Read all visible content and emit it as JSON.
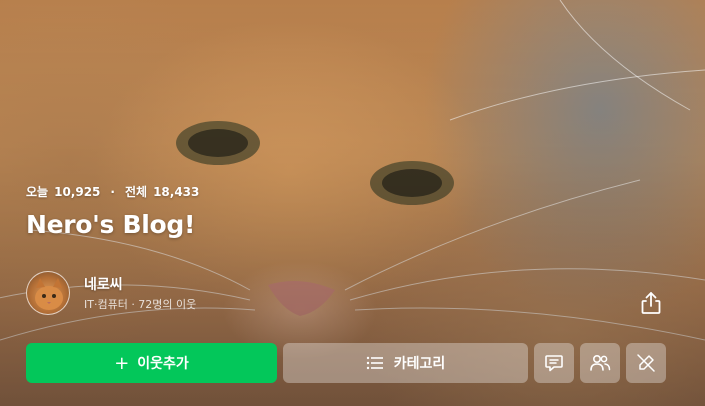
{
  "blog": {
    "title": "Nero's Blog!",
    "stats": {
      "today_label": "오늘",
      "today_count": "10,925",
      "separator": "·",
      "total_label": "전체",
      "total_count": "18,433"
    }
  },
  "profile": {
    "name": "네로씨",
    "subtitle": "IT·컴퓨터 · 72명의 이웃"
  },
  "actions": {
    "follow_icon": "+",
    "follow_label": "이웃추가",
    "category_label": "카테고리"
  },
  "icons": {
    "share": "share-icon",
    "message": "message-icon",
    "neighbors": "people-icon",
    "widget": "pen-off-icon"
  },
  "colors": {
    "follow_button": "#03c75a",
    "text": "#ffffff"
  }
}
